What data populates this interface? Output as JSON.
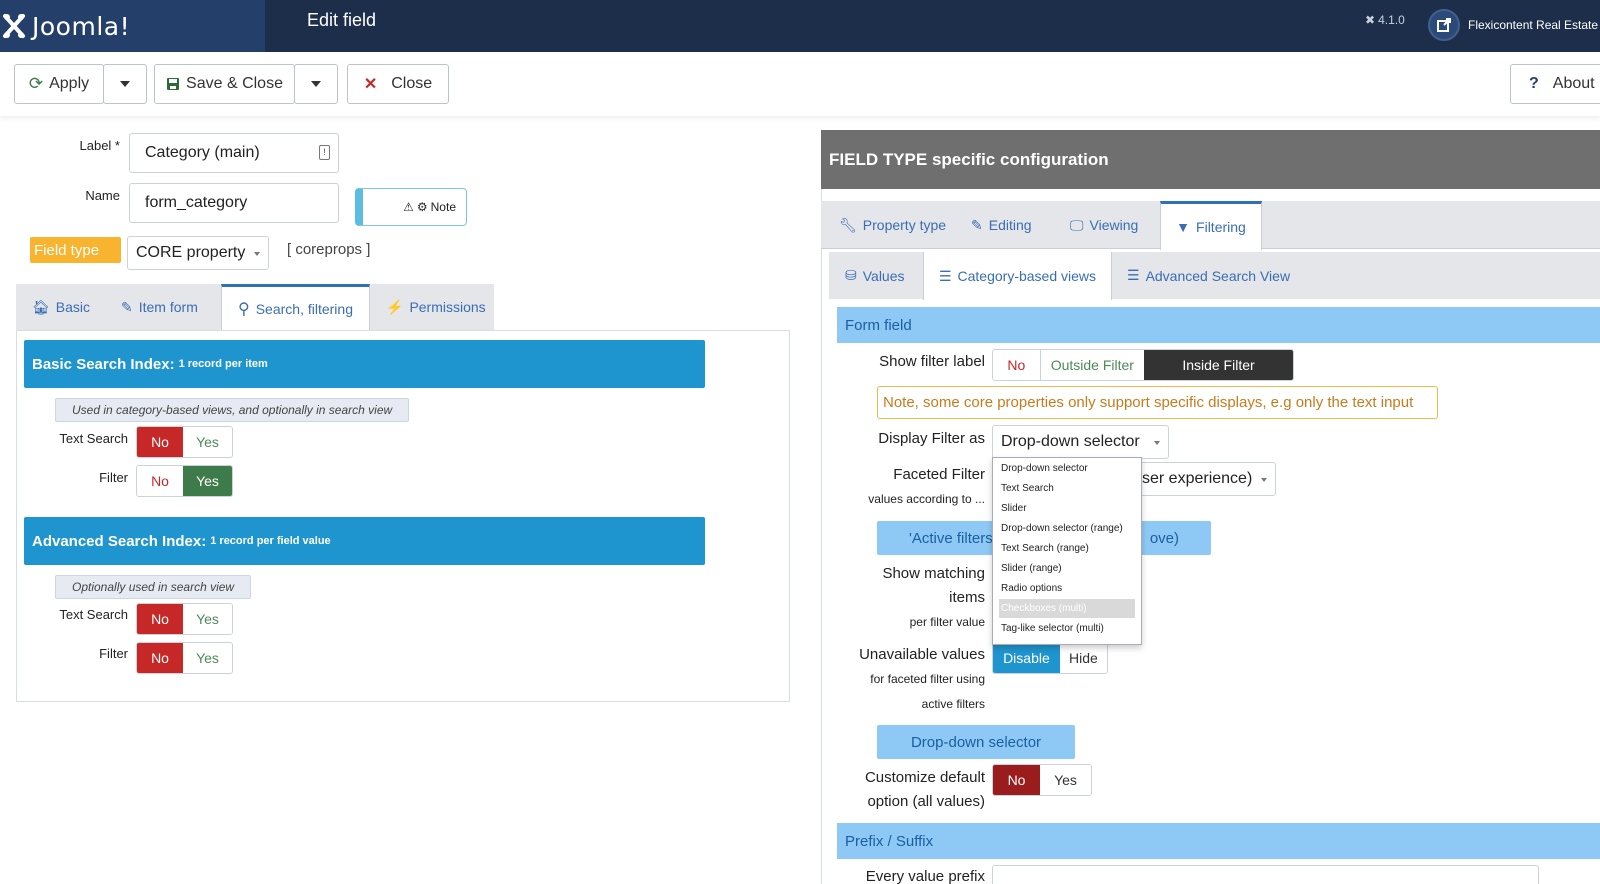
{
  "header": {
    "brand": "Joomla!",
    "page_title": "Edit field",
    "version": "4.1.0",
    "site_name": "Flexicontent Real Estate d"
  },
  "toolbar": {
    "apply": "Apply",
    "save_close": "Save & Close",
    "close": "Close",
    "about": "About"
  },
  "form": {
    "label_label": "Label *",
    "label_value": "Category (main)",
    "name_label": "Name",
    "name_value": "form_category",
    "note": "Note",
    "field_type_label": "Field type",
    "field_type_value": "CORE property",
    "field_type_code": "[ coreprops ]"
  },
  "left_tabs": [
    "Basic",
    "Item form",
    "Search, filtering",
    "Permissions"
  ],
  "basic_index": {
    "title": "Basic Search Index:",
    "subtitle": "1 record per item",
    "hint": "Used in category-based views, and optionally in search view",
    "text_search_label": "Text Search",
    "filter_label": "Filter",
    "no": "No",
    "yes": "Yes"
  },
  "advanced_index": {
    "title": "Advanced Search Index:",
    "subtitle": "1 record per field value",
    "hint": "Optionally used in search view",
    "text_search_label": "Text Search",
    "filter_label": "Filter",
    "no": "No",
    "yes": "Yes"
  },
  "right": {
    "title": "FIELD TYPE specific configuration",
    "tabs": [
      "Property type",
      "Editing",
      "Viewing",
      "Filtering"
    ],
    "subtabs": [
      "Values",
      "Category-based views",
      "Advanced Search View"
    ],
    "form_field_header": "Form field",
    "show_filter_label": "Show filter label",
    "show_filter_options": [
      "No",
      "Outside Filter",
      "Inside Filter"
    ],
    "warning": "Note, some core properties only support specific displays, e.g only the text input",
    "display_filter_label": "Display Filter as",
    "display_filter_value": "Drop-down selector",
    "faceted_label": "Faceted Filter",
    "faceted_sub": "values according to ...",
    "faceted_value_tail": "ser experience)",
    "active_filters_head": "'Active filters",
    "active_filters_tail": "ove)",
    "show_matching_label_1": "Show matching",
    "show_matching_label_2": "items",
    "show_matching_sub": "per filter value",
    "unavailable_label": "Unavailable values",
    "unavailable_sub_1": "for faceted filter using",
    "unavailable_sub_2": "active filters",
    "unavailable_options": [
      "Disable",
      "Hide"
    ],
    "dropdown_selector_btn": "Drop-down selector",
    "customize_label_1": "Customize default",
    "customize_label_2": "option (all values)",
    "customize_options": [
      "No",
      "Yes"
    ],
    "prefix_header": "Prefix / Suffix",
    "every_value_prefix": "Every value prefix"
  },
  "dropdown_options": [
    "Drop-down selector",
    "Text Search",
    "Slider",
    "Drop-down selector (range)",
    "Text Search (range)",
    "Slider (range)",
    "Radio options",
    "Checkboxes (multi)",
    "Tag-like selector (multi)"
  ],
  "dropdown_highlighted": "Checkboxes (multi)",
  "colors": {
    "header_bg": "#1c2e4a",
    "accent_blue": "#1f95cf",
    "no_red": "#c52827",
    "yes_green": "#3e7b4a",
    "section_blue": "#8ec9f6",
    "field_type_badge": "#f9b42f"
  }
}
